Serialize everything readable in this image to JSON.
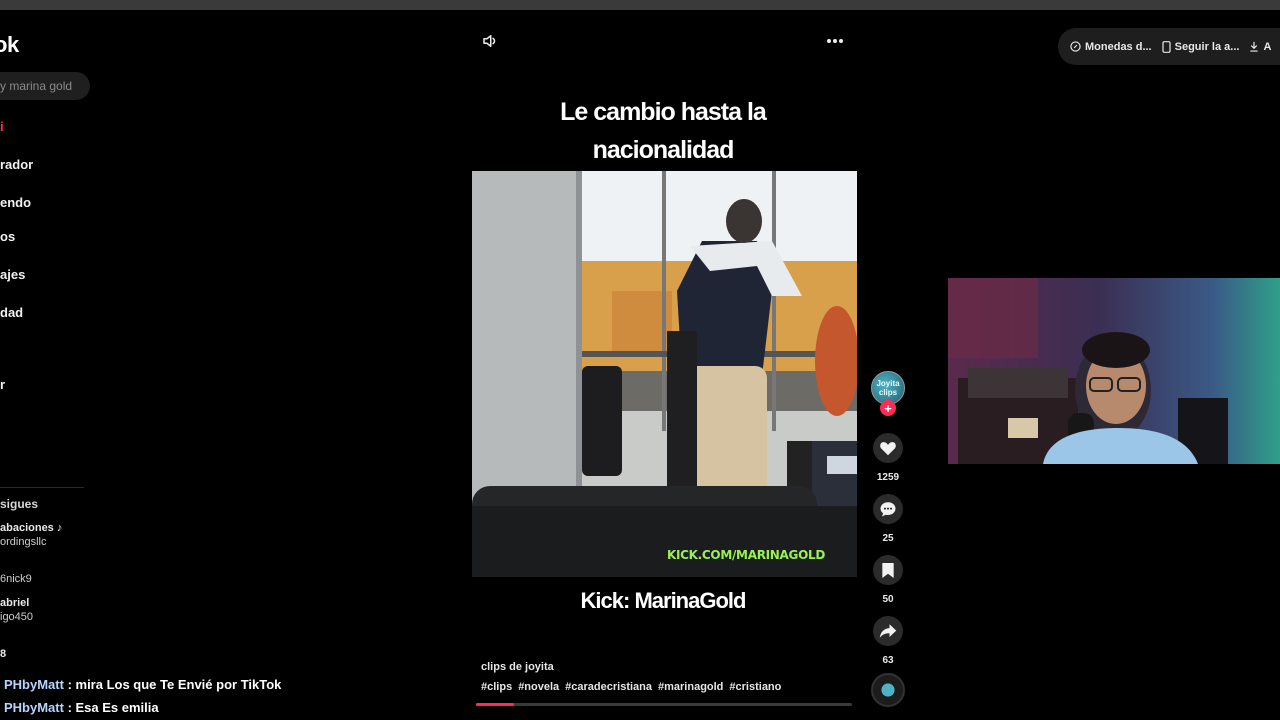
{
  "app": {
    "logo_text": "ok"
  },
  "search": {
    "placeholder": "y marina gold"
  },
  "sidebar": {
    "items": [
      {
        "label": "i",
        "active": true
      },
      {
        "label": "rador"
      },
      {
        "label": "endo"
      },
      {
        "label": "os"
      },
      {
        "label": "ajes"
      },
      {
        "label": "dad"
      },
      {
        "label": "r"
      }
    ],
    "following_title": "sigues",
    "accounts": [
      {
        "name": "abaciones ♪",
        "handle": "ordingsllc"
      },
      {
        "name": "",
        "handle": "6nick9"
      },
      {
        "name": "abriel",
        "handle": "igo450"
      },
      {
        "name": "8",
        "handle": ""
      }
    ]
  },
  "chat": [
    {
      "user": "PHbyMatt",
      "message": " : mira Los que Te Envié por TikTok"
    },
    {
      "user": "PHbyMatt",
      "message": " : Esa Es emilia"
    }
  ],
  "video": {
    "caption_line1": "Le cambio hasta la",
    "caption_line2": "nacionalidad",
    "caption_bottom": "Kick: MarinaGold",
    "watermark": "KICK.COM/MARINAGOLD",
    "author": "clips de joyita",
    "hashtags": [
      "#clips",
      "#novela",
      "#caradecristiana",
      "#marinagold",
      "#cristiano"
    ],
    "progress": 0.1
  },
  "actions": {
    "likes": "1259",
    "comments": "25",
    "saves": "50",
    "shares": "63",
    "avatar_text": "Joyita clips"
  },
  "top_pill": {
    "items": [
      {
        "label": "Monedas d...",
        "icon": "coin-icon"
      },
      {
        "label": "Seguir la a...",
        "icon": "phone-icon"
      },
      {
        "label": "A",
        "icon": "download-icon"
      }
    ]
  },
  "colors": {
    "accent": "#fe2c55",
    "background": "#000000",
    "watermark": "#9cf24a"
  }
}
